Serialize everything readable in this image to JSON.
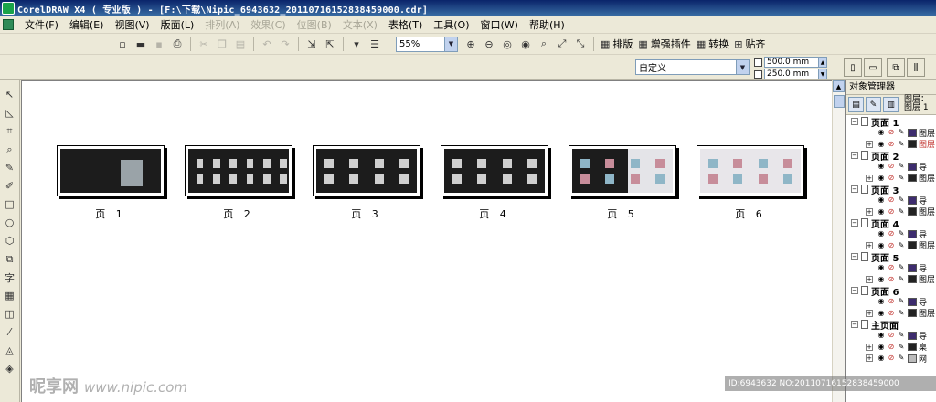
{
  "window": {
    "title": "CorelDRAW X4 ( 专业版 ) - [F:\\下载\\Nipic_6943632_20110716152838459000.cdr]"
  },
  "menu": [
    {
      "label": "文件(F)",
      "disabled": false
    },
    {
      "label": "编辑(E)",
      "disabled": false
    },
    {
      "label": "视图(V)",
      "disabled": false
    },
    {
      "label": "版面(L)",
      "disabled": false
    },
    {
      "label": "排列(A)",
      "disabled": true
    },
    {
      "label": "效果(C)",
      "disabled": true
    },
    {
      "label": "位图(B)",
      "disabled": true
    },
    {
      "label": "文本(X)",
      "disabled": true
    },
    {
      "label": "表格(T)",
      "disabled": false
    },
    {
      "label": "工具(O)",
      "disabled": false
    },
    {
      "label": "窗口(W)",
      "disabled": false
    },
    {
      "label": "帮助(H)",
      "disabled": false
    }
  ],
  "toolbar": {
    "zoom_value": "55%",
    "layout_label": "排版",
    "plugin_label": "增强插件",
    "convert_label": "转换",
    "align_label": "贴齐"
  },
  "propbar": {
    "paper_type": "自定义",
    "width": "500.0 mm",
    "height": "250.0 mm"
  },
  "pages": [
    {
      "label": "页 1",
      "style": "cover"
    },
    {
      "label": "页 2",
      "style": "grid-dark"
    },
    {
      "label": "页 3",
      "style": "dark"
    },
    {
      "label": "页 4",
      "style": "dark"
    },
    {
      "label": "页 5",
      "style": "light-right"
    },
    {
      "label": "页 6",
      "style": "light"
    }
  ],
  "docker": {
    "title": "对象管理器",
    "layer_info_1": "图层：",
    "layer_info_2": "图层 1",
    "pages": [
      {
        "name": "页面 1",
        "layers": [
          {
            "name": "图层",
            "color": "#3d2c6e",
            "red": false
          },
          {
            "name": "图层",
            "color": "#222222",
            "red": true
          }
        ]
      },
      {
        "name": "页面 2",
        "layers": [
          {
            "name": "导",
            "color": "#3d2c6e",
            "red": false
          },
          {
            "name": "图层",
            "color": "#222222",
            "red": false
          }
        ]
      },
      {
        "name": "页面 3",
        "layers": [
          {
            "name": "导",
            "color": "#3d2c6e",
            "red": false
          },
          {
            "name": "图层",
            "color": "#222222",
            "red": false
          }
        ]
      },
      {
        "name": "页面 4",
        "layers": [
          {
            "name": "导",
            "color": "#3d2c6e",
            "red": false
          },
          {
            "name": "图层",
            "color": "#222222",
            "red": false
          }
        ]
      },
      {
        "name": "页面 5",
        "layers": [
          {
            "name": "导",
            "color": "#3d2c6e",
            "red": false
          },
          {
            "name": "图层",
            "color": "#222222",
            "red": false
          }
        ]
      },
      {
        "name": "页面 6",
        "layers": [
          {
            "name": "导",
            "color": "#3d2c6e",
            "red": false
          },
          {
            "name": "图层",
            "color": "#222222",
            "red": false
          }
        ]
      },
      {
        "name": "主页面",
        "layers": [
          {
            "name": "导",
            "color": "#3d2c6e",
            "red": false
          },
          {
            "name": "桌",
            "color": "#222222",
            "red": false
          },
          {
            "name": "网",
            "color": "#bbbbbb",
            "red": false
          }
        ]
      }
    ]
  },
  "watermark": {
    "left_brand": "昵享网",
    "left_site": "www.nipic.com",
    "right_id": "ID:6943632 NO:20110716152838459000"
  }
}
